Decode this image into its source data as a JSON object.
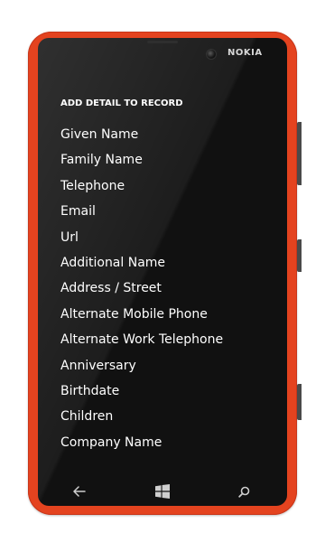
{
  "device": {
    "brand": "NOKIA",
    "body_color": "#e4431f"
  },
  "screen": {
    "title": "ADD DETAIL TO RECORD",
    "items": [
      {
        "label": "Given Name"
      },
      {
        "label": "Family Name"
      },
      {
        "label": "Telephone"
      },
      {
        "label": "Email"
      },
      {
        "label": "Url"
      },
      {
        "label": "Additional Name"
      },
      {
        "label": "Address / Street"
      },
      {
        "label": "Alternate Mobile Phone"
      },
      {
        "label": "Alternate Work Telephone"
      },
      {
        "label": "Anniversary"
      },
      {
        "label": "Birthdate"
      },
      {
        "label": "Children"
      },
      {
        "label": "Company Name"
      }
    ]
  },
  "nav_keys": {
    "back": "back-arrow-icon",
    "start": "windows-logo-icon",
    "search": "search-icon"
  }
}
